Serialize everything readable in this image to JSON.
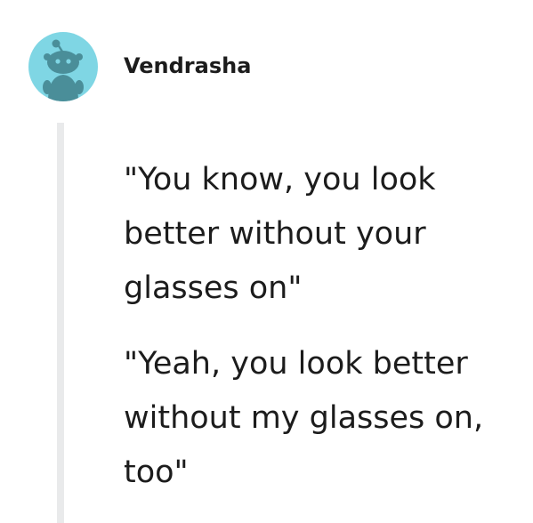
{
  "comment": {
    "author": "Vendrasha",
    "avatar_icon": "reddit-snoo-icon",
    "avatar_color": "#7fd6e4",
    "paragraphs": [
      "\"You know, you look\nbetter without your\nglasses on\"",
      "\"Yeah, you look better\nwithout my glasses on,\ntoo\""
    ]
  }
}
